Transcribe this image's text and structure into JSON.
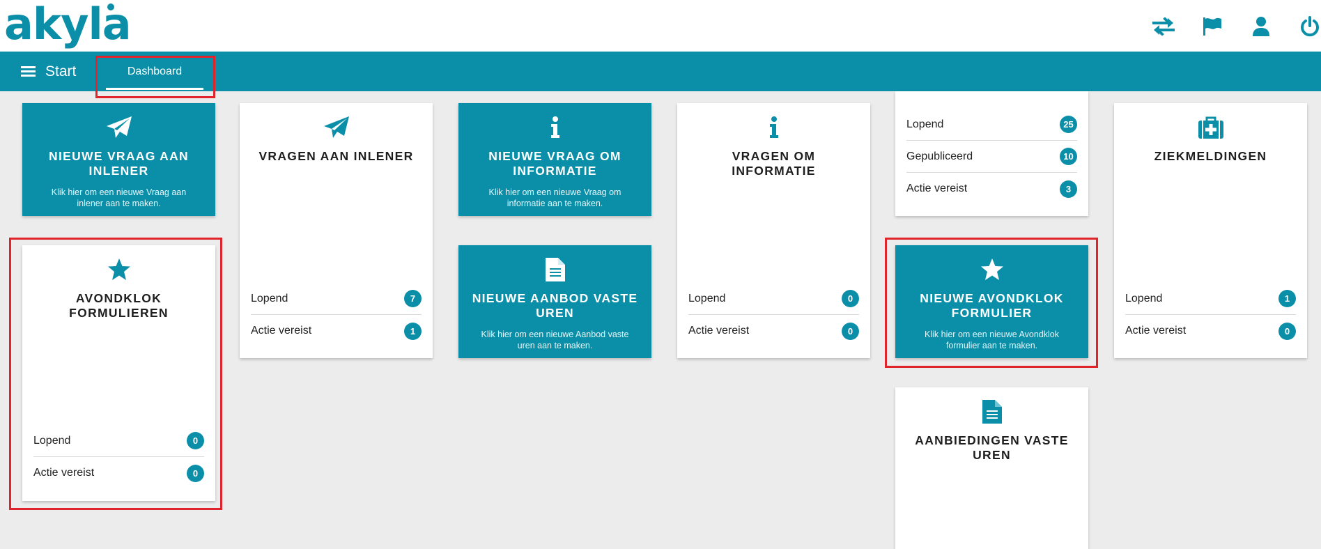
{
  "brand": {
    "name": "akyla"
  },
  "header": {
    "icons": [
      "switch-icon",
      "flag-icon",
      "user-icon",
      "power-icon"
    ]
  },
  "nav": {
    "menu_label": "Start",
    "tabs": [
      {
        "label": "Dashboard"
      }
    ]
  },
  "cards": {
    "new_question_lender": {
      "title": "NIEUWE VRAAG AAN INLENER",
      "description": "Klik hier om een nieuwe Vraag aan inlener aan te maken."
    },
    "questions_lender": {
      "title": "VRAGEN AAN INLENER",
      "rows": [
        {
          "label": "Lopend",
          "count": "7"
        },
        {
          "label": "Actie vereist",
          "count": "1"
        }
      ]
    },
    "new_info_request": {
      "title": "NIEUWE VRAAG OM INFORMATIE",
      "description": "Klik hier om een nieuwe Vraag om informatie aan te maken."
    },
    "info_requests": {
      "title": "VRAGEN OM INFORMATIE",
      "rows": [
        {
          "label": "Lopend",
          "count": "0"
        },
        {
          "label": "Actie vereist",
          "count": "0"
        }
      ]
    },
    "vacancies_partial": {
      "rows": [
        {
          "label": "Lopend",
          "count": "25"
        },
        {
          "label": "Gepubliceerd",
          "count": "10"
        },
        {
          "label": "Actie vereist",
          "count": "3"
        }
      ]
    },
    "sick_reports": {
      "title": "ZIEKMELDINGEN",
      "rows": [
        {
          "label": "Lopend",
          "count": "1"
        },
        {
          "label": "Actie vereist",
          "count": "0"
        }
      ]
    },
    "curfew_forms": {
      "title": "AVONDKLOK FORMULIEREN",
      "rows": [
        {
          "label": "Lopend",
          "count": "0"
        },
        {
          "label": "Actie vereist",
          "count": "0"
        }
      ]
    },
    "new_fixed_hours_offer": {
      "title": "NIEUWE AANBOD VASTE UREN",
      "description": "Klik hier om een nieuwe Aanbod vaste uren aan te maken."
    },
    "new_curfew_form": {
      "title": "NIEUWE AVONDKLOK FORMULIER",
      "description": "Klik hier om een nieuwe Avondklok formulier aan te maken."
    },
    "fixed_hours_offers": {
      "title": "AANBIEDINGEN VASTE UREN"
    }
  },
  "colors": {
    "brand": "#0b8fa9",
    "background": "#ececec",
    "highlight": "#e0242b"
  }
}
